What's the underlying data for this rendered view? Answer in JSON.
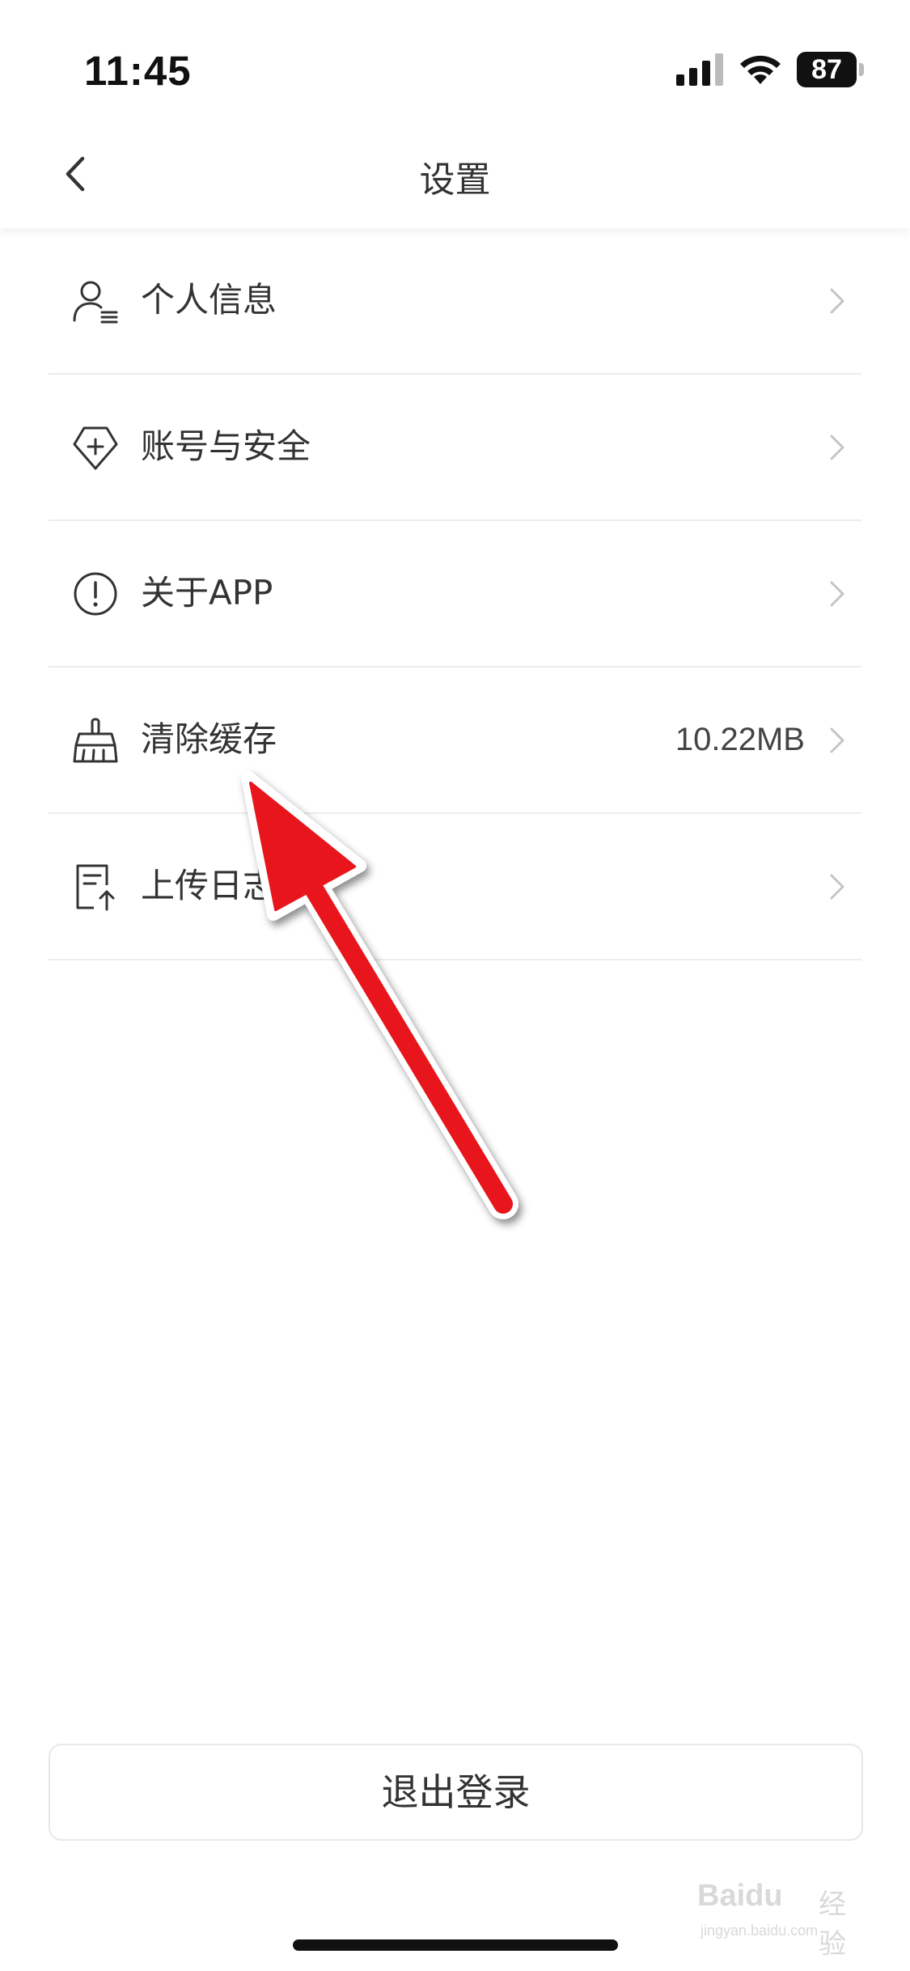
{
  "status_bar": {
    "time": "11:45",
    "battery": "87"
  },
  "nav": {
    "title": "设置"
  },
  "menu": {
    "items": [
      {
        "label": "个人信息",
        "icon": "user-list-icon",
        "value": ""
      },
      {
        "label": "账号与安全",
        "icon": "shield-plus-icon",
        "value": ""
      },
      {
        "label": "关于APP",
        "icon": "info-circle-icon",
        "value": ""
      },
      {
        "label": "清除缓存",
        "icon": "broom-icon",
        "value": "10.22MB"
      },
      {
        "label": "上传日志",
        "icon": "document-upload-icon",
        "value": ""
      }
    ]
  },
  "footer": {
    "logout_label": "退出登录"
  },
  "watermark": {
    "brand": "Baidu",
    "brand_cn": "经验",
    "url": "jingyan.baidu.com"
  },
  "colors": {
    "annotation_arrow": "#e8141c",
    "divider": "#ececec",
    "icon": "#333333"
  }
}
